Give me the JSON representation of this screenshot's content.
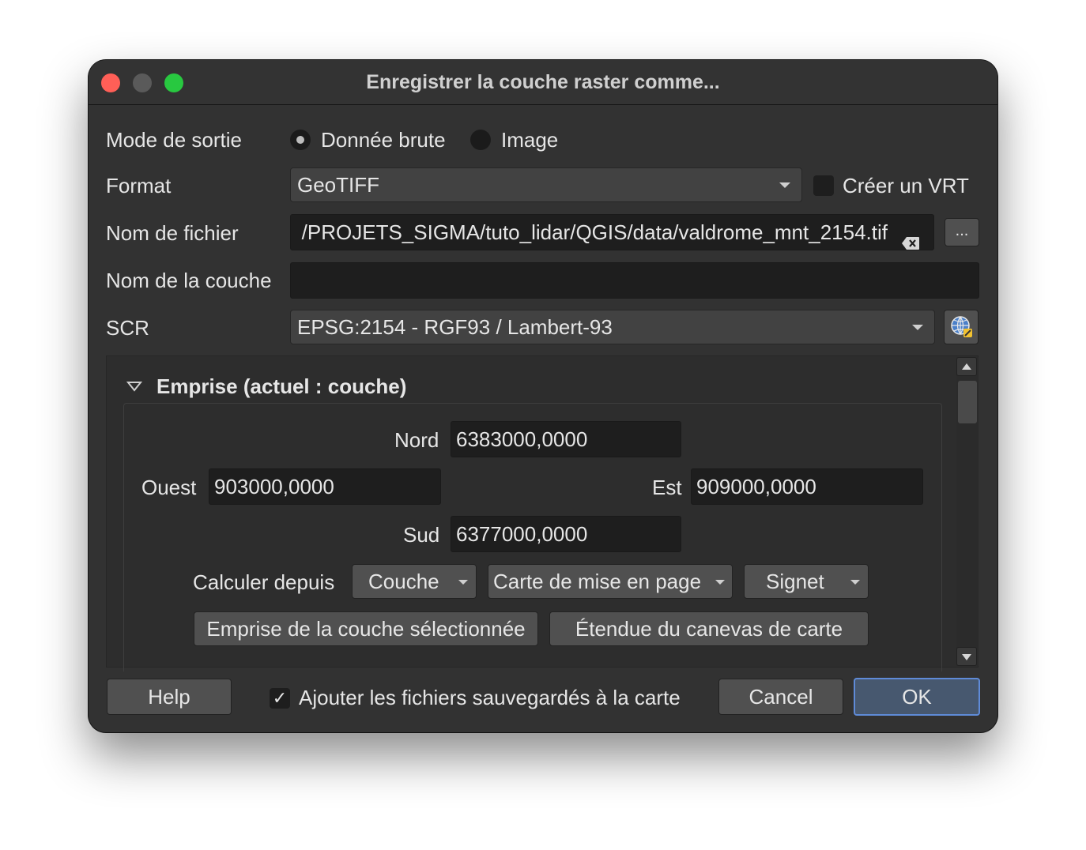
{
  "window": {
    "title": "Enregistrer la couche raster comme..."
  },
  "output_mode": {
    "label": "Mode de sortie",
    "options": [
      {
        "label": "Donnée brute",
        "selected": true
      },
      {
        "label": "Image",
        "selected": false
      }
    ]
  },
  "format": {
    "label": "Format",
    "value": "GeoTIFF",
    "vrt_label": "Créer un VRT",
    "vrt_checked": false
  },
  "filename": {
    "label": "Nom de fichier",
    "value": "/PROJETS_SIGMA/tuto_lidar/QGIS/data/valdrome_mnt_2154.tif",
    "browse_label": "..."
  },
  "layer_name": {
    "label": "Nom de la couche",
    "value": ""
  },
  "crs": {
    "label": "SCR",
    "value": "EPSG:2154 - RGF93 / Lambert-93"
  },
  "extent": {
    "title": "Emprise (actuel : couche)",
    "north_label": "Nord",
    "north": "6383000,0000",
    "west_label": "Ouest",
    "west": "903000,0000",
    "east_label": "Est",
    "east": "909000,0000",
    "south_label": "Sud",
    "south": "6377000,0000",
    "calc_label": "Calculer depuis",
    "calc_layer": "Couche",
    "calc_layout": "Carte de mise en page",
    "calc_bookmark": "Signet",
    "selected_layer_extent": "Emprise de la couche sélectionnée",
    "canvas_extent": "Étendue du canevas de carte"
  },
  "footer": {
    "help": "Help",
    "add_to_map_label": "Ajouter les fichiers sauvegardés à la carte",
    "add_to_map_checked": true,
    "add_to_map_mark": "✓",
    "cancel": "Cancel",
    "ok": "OK"
  }
}
